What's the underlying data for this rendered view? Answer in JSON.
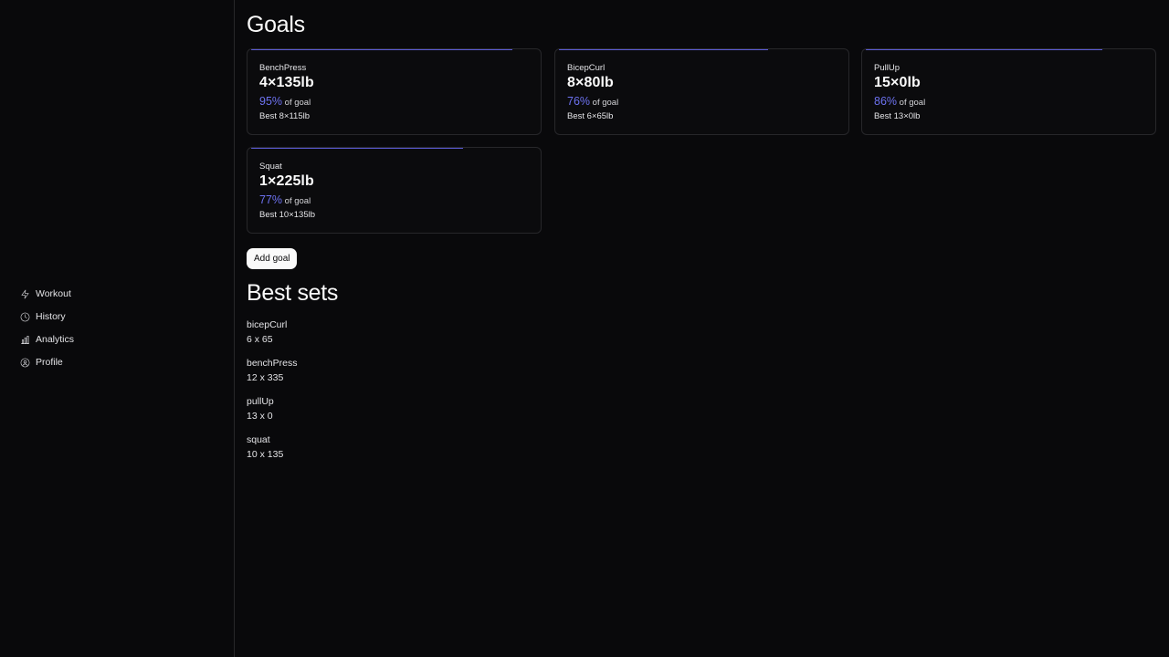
{
  "nav": {
    "items": [
      {
        "label": "Workout",
        "icon": "lightning-icon"
      },
      {
        "label": "History",
        "icon": "clock-icon"
      },
      {
        "label": "Analytics",
        "icon": "bar-chart-icon"
      },
      {
        "label": "Profile",
        "icon": "user-circle-icon"
      }
    ]
  },
  "goals": {
    "title": "Goals",
    "cards": [
      {
        "name": "BenchPress",
        "target": "4×135lb",
        "percent": "95%",
        "percent_value": 0.95,
        "of_goal": "of goal",
        "best": "Best 8×115lb"
      },
      {
        "name": "BicepCurl",
        "target": "8×80lb",
        "percent": "76%",
        "percent_value": 0.76,
        "of_goal": "of goal",
        "best": "Best 6×65lb"
      },
      {
        "name": "PullUp",
        "target": "15×0lb",
        "percent": "86%",
        "percent_value": 0.86,
        "of_goal": "of goal",
        "best": "Best 13×0lb"
      },
      {
        "name": "Squat",
        "target": "1×225lb",
        "percent": "77%",
        "percent_value": 0.77,
        "of_goal": "of goal",
        "best": "Best 10×135lb"
      }
    ],
    "add_label": "Add goal"
  },
  "best_sets": {
    "title": "Best sets",
    "items": [
      {
        "name": "bicepCurl",
        "value": "6 x 65"
      },
      {
        "name": "benchPress",
        "value": "12 x 335"
      },
      {
        "name": "pullUp",
        "value": "13 x 0"
      },
      {
        "name": "squat",
        "value": "10 x 135"
      }
    ]
  },
  "colors": {
    "background": "#09090b",
    "accent": "#6d72f0",
    "border": "#27272a"
  }
}
